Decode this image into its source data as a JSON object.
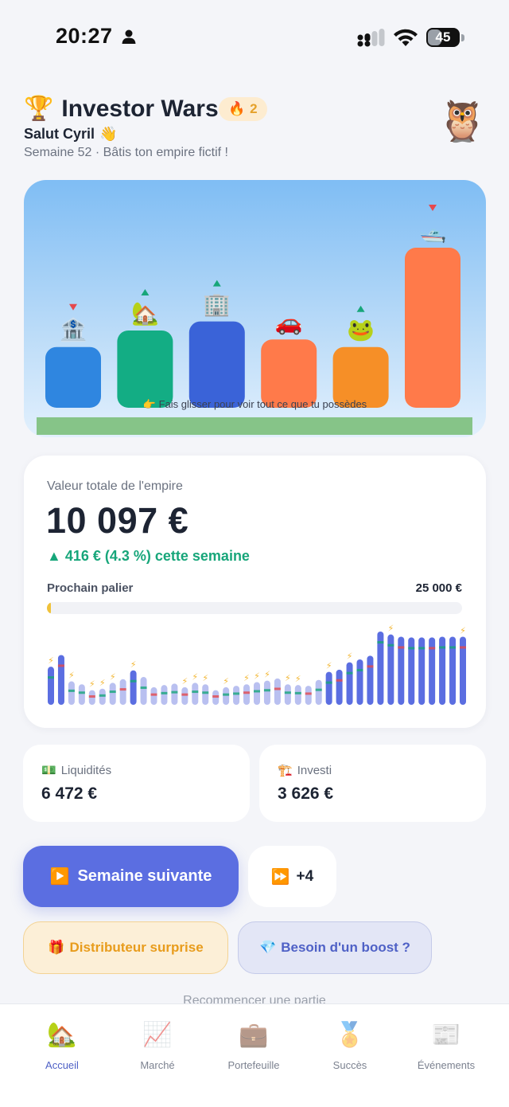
{
  "status": {
    "time": "20:27",
    "battery": "45",
    "battery_level": 0.45
  },
  "header": {
    "trophy_icon": "🏆",
    "title": "Investor Wars",
    "streak_icon": "🔥",
    "streak_count": "2",
    "greeting": "Salut Cyril",
    "greeting_icon": "👋",
    "subtitle": "Semaine 52 · Bâtis ton empire fictif !",
    "avatar_icon": "🦉"
  },
  "scene": {
    "hint": "👉 Fais glisser pour voir tout ce que tu possèdes",
    "buildings": [
      {
        "icon": "🏦",
        "name": "bank",
        "color": "#2f86e0",
        "trend": "down",
        "level": 0.34
      },
      {
        "icon": "🏡",
        "name": "house",
        "color": "#13ad84",
        "trend": "up",
        "level": 0.45
      },
      {
        "icon": "🏢",
        "name": "office",
        "color": "#3a63d8",
        "trend": "up",
        "level": 0.51
      },
      {
        "icon": "🚗",
        "name": "car",
        "color": "#ff7a4a",
        "trend": "none",
        "level": 0.39
      },
      {
        "icon": "🐸",
        "name": "frog",
        "color": "#f68f27",
        "trend": "up",
        "level": 0.34
      },
      {
        "icon": "🛥️",
        "name": "yacht",
        "color": "#ff7a4a",
        "trend": "down",
        "level": 1.0
      }
    ]
  },
  "empire": {
    "label": "Valeur totale de l'empire",
    "value": "10 097 €",
    "change": "▲ 416 € (4.3 %) cette semaine",
    "next_label": "Prochain palier",
    "next_value": "25 000 €",
    "progress": 0.01,
    "history": [
      {
        "v": 0.52,
        "b": 1
      },
      {
        "v": 0.68,
        "b": 0
      },
      {
        "v": 0.32,
        "b": 1
      },
      {
        "v": 0.28,
        "b": 0
      },
      {
        "v": 0.2,
        "b": 1
      },
      {
        "v": 0.22,
        "b": 1
      },
      {
        "v": 0.3,
        "b": 1
      },
      {
        "v": 0.35,
        "b": 0
      },
      {
        "v": 0.47,
        "b": 1
      },
      {
        "v": 0.38,
        "b": 0
      },
      {
        "v": 0.24,
        "b": 0
      },
      {
        "v": 0.27,
        "b": 0
      },
      {
        "v": 0.29,
        "b": 0
      },
      {
        "v": 0.24,
        "b": 1
      },
      {
        "v": 0.3,
        "b": 1
      },
      {
        "v": 0.28,
        "b": 1
      },
      {
        "v": 0.2,
        "b": 0
      },
      {
        "v": 0.24,
        "b": 1
      },
      {
        "v": 0.26,
        "b": 0
      },
      {
        "v": 0.28,
        "b": 1
      },
      {
        "v": 0.31,
        "b": 1
      },
      {
        "v": 0.33,
        "b": 1
      },
      {
        "v": 0.36,
        "b": 0
      },
      {
        "v": 0.28,
        "b": 1
      },
      {
        "v": 0.27,
        "b": 1
      },
      {
        "v": 0.26,
        "b": 0
      },
      {
        "v": 0.34,
        "b": 0
      },
      {
        "v": 0.45,
        "b": 1
      },
      {
        "v": 0.48,
        "b": 0
      },
      {
        "v": 0.58,
        "b": 1
      },
      {
        "v": 0.62,
        "b": 0
      },
      {
        "v": 0.67,
        "b": 0
      },
      {
        "v": 1.0,
        "b": 0
      },
      {
        "v": 0.96,
        "b": 1
      },
      {
        "v": 0.93,
        "b": 0
      },
      {
        "v": 0.92,
        "b": 0
      },
      {
        "v": 0.92,
        "b": 0
      },
      {
        "v": 0.92,
        "b": 0
      },
      {
        "v": 0.93,
        "b": 0
      },
      {
        "v": 0.93,
        "b": 0
      },
      {
        "v": 0.93,
        "b": 1
      }
    ]
  },
  "cash": {
    "icon": "💵",
    "label": "Liquidités",
    "value": "6 472 €"
  },
  "invested": {
    "icon": "🏗️",
    "label": "Investi",
    "value": "3 626 €"
  },
  "actions": {
    "next_icon": "▶️",
    "next_label": "Semaine suivante",
    "skip_icon": "⏩",
    "skip_label": "+4",
    "surprise_icon": "🎁",
    "surprise_label": "Distributeur surprise",
    "boost_icon": "💎",
    "boost_label": "Besoin d'un boost ?",
    "restart": "Recommencer une partie"
  },
  "tabs": [
    {
      "icon": "🏡",
      "label": "Accueil",
      "active": true
    },
    {
      "icon": "📈",
      "label": "Marché",
      "active": false
    },
    {
      "icon": "💼",
      "label": "Portefeuille",
      "active": false
    },
    {
      "icon": "🏅",
      "label": "Succès",
      "active": false
    },
    {
      "icon": "📰",
      "label": "Événements",
      "active": false
    }
  ],
  "colors": {
    "accent": "#5b6ee1",
    "positive": "#17a67a",
    "negative": "#e5484d",
    "bolt": "#f2b632"
  }
}
